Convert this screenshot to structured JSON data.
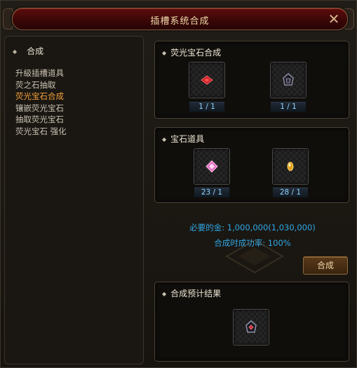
{
  "window": {
    "title": "插槽系统合成",
    "close_symbol": "✕"
  },
  "sidebar": {
    "header": "合成",
    "items": [
      {
        "label": "升級插槽道具",
        "active": false
      },
      {
        "label": "荧之石抽取",
        "active": false
      },
      {
        "label": "荧光宝石合成",
        "active": true
      },
      {
        "label": "镶嵌荧光宝石",
        "active": false
      },
      {
        "label": "抽取荧光宝石",
        "active": false
      },
      {
        "label": "荧光宝石 强化",
        "active": false
      }
    ]
  },
  "sections": {
    "gem_craft": {
      "title": "荧光宝石合成",
      "slots": [
        {
          "icon": "red-crystal-icon",
          "count": "1 / 1"
        },
        {
          "icon": "socket-stone-icon",
          "count": "1 / 1"
        }
      ]
    },
    "gem_items": {
      "title": "宝石道具",
      "slots": [
        {
          "icon": "pink-jewel-icon",
          "count": "23 / 1"
        },
        {
          "icon": "amber-gem-icon",
          "count": "28 / 1"
        }
      ]
    },
    "result": {
      "title": "合成预计结果",
      "slot": {
        "icon": "fluorescent-gem-result-icon"
      }
    }
  },
  "cost": {
    "label": "必要的金",
    "value": "1,000,000(1,030,000)",
    "text": "必要的金: 1,000,000(1,030,000)"
  },
  "success": {
    "text": "合成时成功率: 100%"
  },
  "craft_button": {
    "label": "合成"
  },
  "colors": {
    "active_menu": "#f5a13a",
    "info_text": "#2fa8e6",
    "count_text": "#8fd3ff"
  }
}
